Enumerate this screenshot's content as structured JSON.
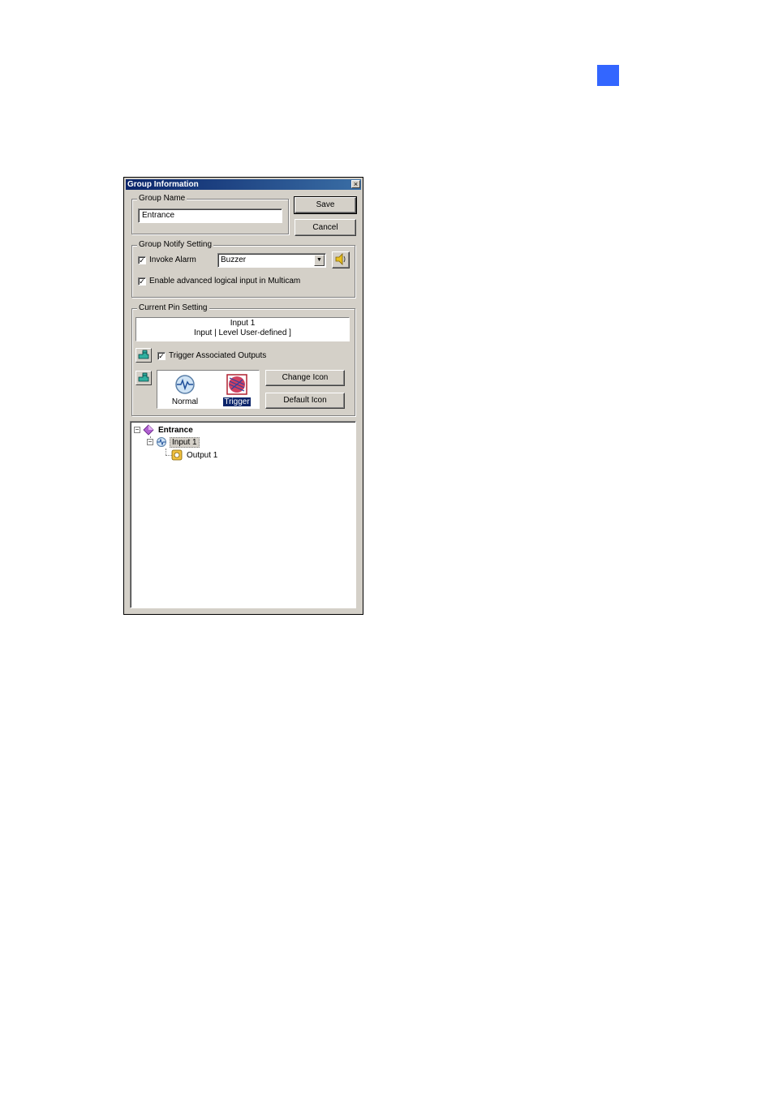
{
  "page": {
    "marker_color": "#3366ff"
  },
  "dialog": {
    "title": "Group Information",
    "close_glyph": "×",
    "group_name": {
      "legend": "Group Name",
      "value": "Entrance"
    },
    "buttons": {
      "save": "Save",
      "cancel": "Cancel"
    },
    "notify": {
      "legend": "Group Notify Setting",
      "invoke_alarm": {
        "label": "Invoke Alarm",
        "checked": true
      },
      "alarm_select": {
        "value": "Buzzer"
      },
      "sound_icon": "speaker-icon",
      "advanced": {
        "label": "Enable advanced logical input in Multicam",
        "checked": true
      }
    },
    "pin": {
      "legend": "Current Pin Setting",
      "name": "Input 1",
      "description": "Input | Level User-defined ]",
      "trigger_outputs": {
        "label": "Trigger Associated Outputs",
        "checked": true
      },
      "icons": [
        {
          "label": "Normal",
          "icon": "normal-state-icon",
          "selected": false
        },
        {
          "label": "Trigger",
          "icon": "trigger-state-icon",
          "selected": true
        }
      ],
      "change_icon": "Change Icon",
      "default_icon": "Default Icon"
    },
    "tree": {
      "root": "Entrance",
      "child": "Input 1",
      "grandchild": "Output 1",
      "collapse_glyph": "−"
    }
  },
  "check_glyph": "✓"
}
